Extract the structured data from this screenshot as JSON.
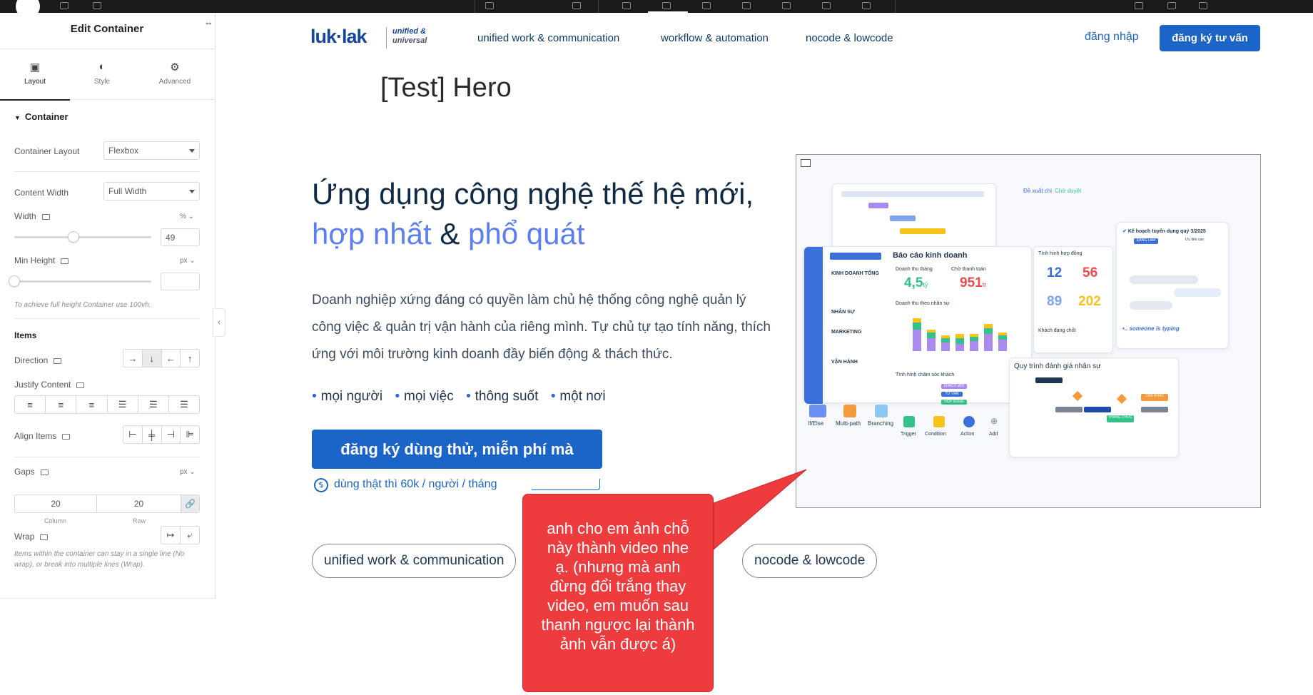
{
  "panel": {
    "title": "Edit Container",
    "tabs": [
      {
        "label": "Layout",
        "icon": "layout-icon"
      },
      {
        "label": "Style",
        "icon": "style-icon"
      },
      {
        "label": "Advanced",
        "icon": "gear-icon"
      }
    ],
    "section": "Container",
    "container_layout": {
      "label": "Container Layout",
      "value": "Flexbox"
    },
    "content_width": {
      "label": "Content Width",
      "value": "Full Width"
    },
    "width": {
      "label": "Width",
      "unit": "%",
      "value": "49",
      "level": 0.43
    },
    "min_height": {
      "label": "Min Height",
      "unit": "px",
      "value": "",
      "level": 0
    },
    "min_height_hint": "To achieve full height Container use 100vh.",
    "items_title": "Items",
    "direction": {
      "label": "Direction",
      "options": [
        "→",
        "↓",
        "←",
        "↑"
      ],
      "selected": 1
    },
    "justify": {
      "label": "Justify Content"
    },
    "align": {
      "label": "Align Items"
    },
    "gaps": {
      "label": "Gaps",
      "unit": "px",
      "column": "20",
      "row": "20",
      "column_label": "Column",
      "row_label": "Row"
    },
    "wrap": {
      "label": "Wrap",
      "hint": "Items within the container can stay in a single line (No wrap), or break into multiple lines (Wrap)."
    }
  },
  "site": {
    "logo": "luk·lak",
    "logo_tag1": "unified &",
    "logo_tag2": "universal",
    "nav": [
      "unified work & communication",
      "workflow & automation",
      "nocode & lowcode"
    ],
    "login": "đăng nhập",
    "cta_top": "đăng ký tư vấn",
    "hero_test": "[Test] Hero",
    "headline_line1": "Ứng dụng công nghệ thế hệ mới,",
    "headline_blue1": "hợp nhất",
    "headline_amp": " & ",
    "headline_blue2": "phổ quát",
    "description": "Doanh nghiệp xứng đáng có quyền làm chủ hệ thống công nghệ quản lý công việc & quản trị vận hành của riêng mình. Tự chủ tự tạo tính năng, thích ứng với môi trường kinh doanh đầy biến động & thách thức.",
    "bullets": [
      "mọi người",
      "mọi việc",
      "thông suốt",
      "một nơi"
    ],
    "cta_main": "đăng ký dùng thử, miễn phí mà",
    "price": "dùng thật thì 60k / người / tháng",
    "pills": [
      "unified work & communication",
      "nocode & lowcode"
    ]
  },
  "mockup": {
    "report_title": "Báo cáo kinh doanh",
    "monthly_revenue_label": "Doanh thu tháng",
    "monthly_revenue": "4,5",
    "monthly_revenue_unit": "tỷ",
    "pending_label": "Chờ thanh toán",
    "pending": "951",
    "pending_unit": "tr",
    "contracts_label": "Tình hình hợp đồng",
    "contracts": [
      "12",
      "56",
      "89",
      "202"
    ],
    "staff_revenue_label": "Doanh thu theo nhân sự",
    "customer_care_label": "Tình hình chăm sóc khách",
    "closing_label": "Khách đang chốt",
    "sidebar_items": [
      "KINH DOANH TỔNG",
      "NHÂN SỰ",
      "MARKETING",
      "VẬN HÀNH"
    ],
    "plan_title": "Kế hoạch tuyển dụng quý 3/2025",
    "plan_badge": "ĐANG LÀM",
    "plan_priority": "Ưu tiên cao",
    "typing": "someone is typing",
    "hr_eval_title": "Quy trình đánh giá nhân sự",
    "approve_labels": [
      "Đề xuất chi",
      "Chờ duyệt"
    ],
    "chips": [
      "KHÁCH MỚI",
      "TƯ VẤN",
      "HỢP ĐỒNG"
    ],
    "flow_tags": [
      "CẦN NHẮC",
      "THĂNG CHỨC"
    ],
    "tools_top": [
      "If/Else",
      "Multi-path",
      "Branching"
    ],
    "tools_bottom": [
      "Trigger",
      "Condition",
      "Action",
      "Add"
    ],
    "colors": {
      "blue": "#3b6fd9",
      "yellow": "#f7c21a",
      "green": "#34c28a",
      "red": "#f04c4c",
      "purple": "#a98bf0",
      "orange": "#f59a3a"
    }
  },
  "callout": {
    "text": "anh cho em ảnh chỗ này thành video nhe ạ. (nhưng mà anh đừng đổi trắng thay video, em muốn sau thanh ngược lại thành ảnh vẫn được á)"
  }
}
